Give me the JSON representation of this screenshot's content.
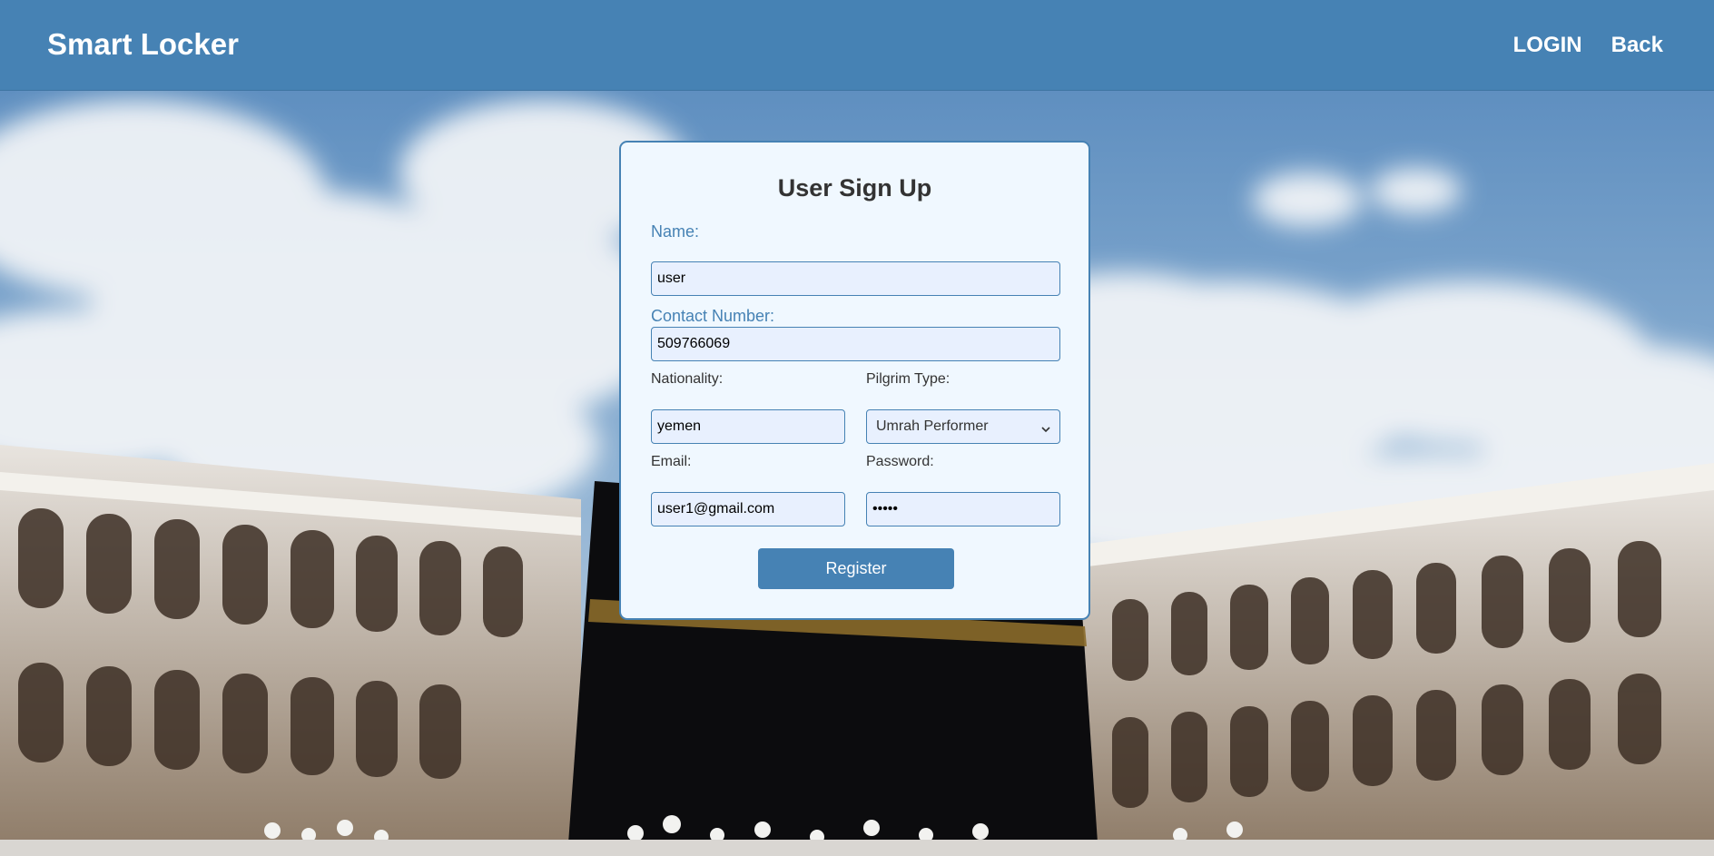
{
  "header": {
    "brand": "Smart Locker",
    "nav": {
      "login": "LOGIN",
      "back": "Back"
    }
  },
  "form": {
    "title": "User Sign Up",
    "name": {
      "label": "Name:",
      "value": "user"
    },
    "contact": {
      "label": "Contact Number:",
      "value": "509766069"
    },
    "nationality": {
      "label": "Nationality:",
      "value": "yemen"
    },
    "pilgrim_type": {
      "label": "Pilgrim Type:",
      "value": "Umrah Performer"
    },
    "email": {
      "label": "Email:",
      "value": "user1@gmail.com"
    },
    "password": {
      "label": "Password:",
      "value": "•••••"
    },
    "submit_label": "Register"
  },
  "colors": {
    "header": "#4682b4",
    "card_bg": "#f0f8ff",
    "accent": "#4682b4",
    "input_bg": "#e8f0fe"
  },
  "icons": {
    "select_arrow": "chevron-down-icon"
  }
}
